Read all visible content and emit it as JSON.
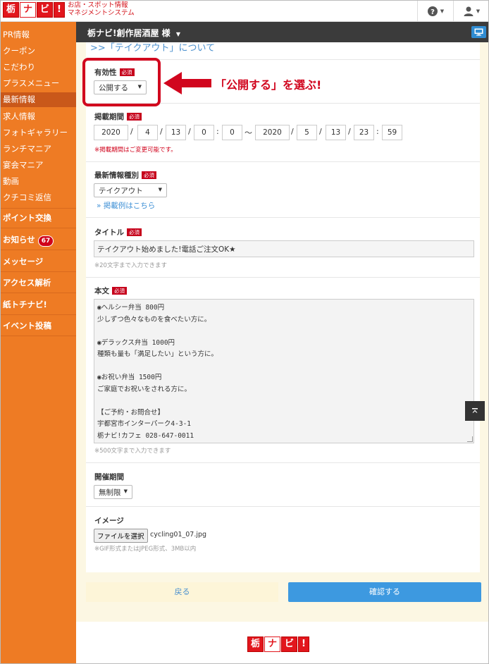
{
  "header": {
    "logo_chars": [
      "栃",
      "ナ",
      "ビ",
      "!"
    ],
    "tagline_1": "お店・スポット情報",
    "tagline_2": "マネジメントシステム"
  },
  "sidebar": {
    "items": [
      {
        "label": "PR情報"
      },
      {
        "label": "クーポン"
      },
      {
        "label": "こだわり"
      },
      {
        "label": "プラスメニュー"
      },
      {
        "label": "最新情報"
      },
      {
        "label": "求人情報"
      },
      {
        "label": "フォトギャラリー"
      },
      {
        "label": "ランチマニア"
      },
      {
        "label": "宴会マニア"
      },
      {
        "label": "動画"
      },
      {
        "label": "クチコミ返信"
      },
      {
        "label": "ポイント交換"
      },
      {
        "label": "お知らせ"
      },
      {
        "label": "メッセージ"
      },
      {
        "label": "アクセス解析"
      },
      {
        "label": "紙トチナビ!"
      },
      {
        "label": "イベント投稿"
      }
    ],
    "notice_badge": "67"
  },
  "nav": {
    "store_name": "栃ナビ!創作居酒屋 様"
  },
  "form": {
    "heading_partial": ">>「テイクアウト」について",
    "required_badge": "必須",
    "validity": {
      "label": "有効性",
      "value": "公開する"
    },
    "period": {
      "label": "掲載期間",
      "start": {
        "year": "2020",
        "month": "4",
        "day": "13",
        "hour": "0",
        "minute": "0"
      },
      "end": {
        "year": "2020",
        "month": "5",
        "day": "13",
        "hour": "23",
        "minute": "59"
      },
      "tilde": "〜",
      "slash": "/",
      "colon": ":",
      "note": "※掲載期間はご変更可能です。"
    },
    "type": {
      "label": "最新情報種別",
      "value": "テイクアウト",
      "link": "» 掲載例はこちら"
    },
    "title": {
      "label": "タイトル",
      "value": "テイクアウト始めました!電話ご注文OK★",
      "note": "※20文字まで入力できます"
    },
    "body": {
      "label": "本文",
      "value": "◉ヘルシー弁当 800円\n少しずつ色々なものを食べたい方に。\n\n◉デラックス弁当 1000円\n種類も量も「満足したい」という方に。\n\n◉お祝い弁当 1500円\nご家庭でお祝いをされる方に。\n\n【ご予約・お問合せ】\n宇都宮市インターパーク4-3-1\n栃ナビ!カフェ 028-647-0011",
      "note": "※500文字まで入力できます"
    },
    "duration": {
      "label": "開催期間",
      "value": "無制限"
    },
    "image": {
      "label": "イメージ",
      "button": "ファイルを選択",
      "filename": "cycling01_07.jpg",
      "note": "※GIF形式またはJPEG形式、3MB以内"
    },
    "back_button": "戻る",
    "confirm_button": "確認する"
  },
  "annotation": {
    "text": "「公開する」を選ぶ!"
  },
  "colors": {
    "sidebar": "#ee7b24",
    "brand_red": "#e2161d",
    "confirm_blue": "#3d99e0",
    "annotation_red": "#d1061e"
  },
  "icons": {
    "help": "question-circle-icon",
    "user": "user-icon",
    "monitor": "monitor-icon",
    "scroll_top": "arrow-up-to-top-icon"
  }
}
